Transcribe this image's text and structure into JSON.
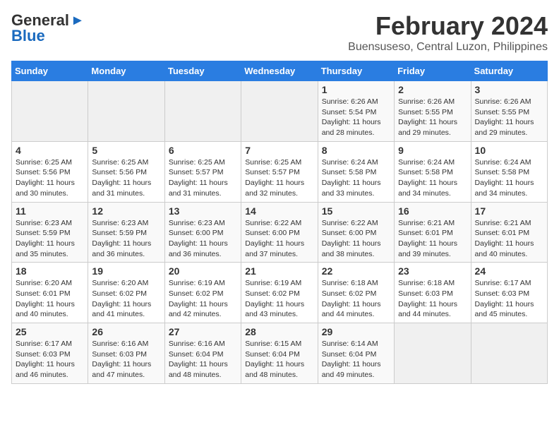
{
  "logo": {
    "line1": "General",
    "line2": "Blue",
    "arrow": "▶"
  },
  "title": "February 2024",
  "subtitle": "Buensuseso, Central Luzon, Philippines",
  "days_of_week": [
    "Sunday",
    "Monday",
    "Tuesday",
    "Wednesday",
    "Thursday",
    "Friday",
    "Saturday"
  ],
  "weeks": [
    [
      {
        "day": "",
        "info": ""
      },
      {
        "day": "",
        "info": ""
      },
      {
        "day": "",
        "info": ""
      },
      {
        "day": "",
        "info": ""
      },
      {
        "day": "1",
        "info": "Sunrise: 6:26 AM\nSunset: 5:54 PM\nDaylight: 11 hours\nand 28 minutes."
      },
      {
        "day": "2",
        "info": "Sunrise: 6:26 AM\nSunset: 5:55 PM\nDaylight: 11 hours\nand 29 minutes."
      },
      {
        "day": "3",
        "info": "Sunrise: 6:26 AM\nSunset: 5:55 PM\nDaylight: 11 hours\nand 29 minutes."
      }
    ],
    [
      {
        "day": "4",
        "info": "Sunrise: 6:25 AM\nSunset: 5:56 PM\nDaylight: 11 hours\nand 30 minutes."
      },
      {
        "day": "5",
        "info": "Sunrise: 6:25 AM\nSunset: 5:56 PM\nDaylight: 11 hours\nand 31 minutes."
      },
      {
        "day": "6",
        "info": "Sunrise: 6:25 AM\nSunset: 5:57 PM\nDaylight: 11 hours\nand 31 minutes."
      },
      {
        "day": "7",
        "info": "Sunrise: 6:25 AM\nSunset: 5:57 PM\nDaylight: 11 hours\nand 32 minutes."
      },
      {
        "day": "8",
        "info": "Sunrise: 6:24 AM\nSunset: 5:58 PM\nDaylight: 11 hours\nand 33 minutes."
      },
      {
        "day": "9",
        "info": "Sunrise: 6:24 AM\nSunset: 5:58 PM\nDaylight: 11 hours\nand 34 minutes."
      },
      {
        "day": "10",
        "info": "Sunrise: 6:24 AM\nSunset: 5:58 PM\nDaylight: 11 hours\nand 34 minutes."
      }
    ],
    [
      {
        "day": "11",
        "info": "Sunrise: 6:23 AM\nSunset: 5:59 PM\nDaylight: 11 hours\nand 35 minutes."
      },
      {
        "day": "12",
        "info": "Sunrise: 6:23 AM\nSunset: 5:59 PM\nDaylight: 11 hours\nand 36 minutes."
      },
      {
        "day": "13",
        "info": "Sunrise: 6:23 AM\nSunset: 6:00 PM\nDaylight: 11 hours\nand 36 minutes."
      },
      {
        "day": "14",
        "info": "Sunrise: 6:22 AM\nSunset: 6:00 PM\nDaylight: 11 hours\nand 37 minutes."
      },
      {
        "day": "15",
        "info": "Sunrise: 6:22 AM\nSunset: 6:00 PM\nDaylight: 11 hours\nand 38 minutes."
      },
      {
        "day": "16",
        "info": "Sunrise: 6:21 AM\nSunset: 6:01 PM\nDaylight: 11 hours\nand 39 minutes."
      },
      {
        "day": "17",
        "info": "Sunrise: 6:21 AM\nSunset: 6:01 PM\nDaylight: 11 hours\nand 40 minutes."
      }
    ],
    [
      {
        "day": "18",
        "info": "Sunrise: 6:20 AM\nSunset: 6:01 PM\nDaylight: 11 hours\nand 40 minutes."
      },
      {
        "day": "19",
        "info": "Sunrise: 6:20 AM\nSunset: 6:02 PM\nDaylight: 11 hours\nand 41 minutes."
      },
      {
        "day": "20",
        "info": "Sunrise: 6:19 AM\nSunset: 6:02 PM\nDaylight: 11 hours\nand 42 minutes."
      },
      {
        "day": "21",
        "info": "Sunrise: 6:19 AM\nSunset: 6:02 PM\nDaylight: 11 hours\nand 43 minutes."
      },
      {
        "day": "22",
        "info": "Sunrise: 6:18 AM\nSunset: 6:02 PM\nDaylight: 11 hours\nand 44 minutes."
      },
      {
        "day": "23",
        "info": "Sunrise: 6:18 AM\nSunset: 6:03 PM\nDaylight: 11 hours\nand 44 minutes."
      },
      {
        "day": "24",
        "info": "Sunrise: 6:17 AM\nSunset: 6:03 PM\nDaylight: 11 hours\nand 45 minutes."
      }
    ],
    [
      {
        "day": "25",
        "info": "Sunrise: 6:17 AM\nSunset: 6:03 PM\nDaylight: 11 hours\nand 46 minutes."
      },
      {
        "day": "26",
        "info": "Sunrise: 6:16 AM\nSunset: 6:03 PM\nDaylight: 11 hours\nand 47 minutes."
      },
      {
        "day": "27",
        "info": "Sunrise: 6:16 AM\nSunset: 6:04 PM\nDaylight: 11 hours\nand 48 minutes."
      },
      {
        "day": "28",
        "info": "Sunrise: 6:15 AM\nSunset: 6:04 PM\nDaylight: 11 hours\nand 48 minutes."
      },
      {
        "day": "29",
        "info": "Sunrise: 6:14 AM\nSunset: 6:04 PM\nDaylight: 11 hours\nand 49 minutes."
      },
      {
        "day": "",
        "info": ""
      },
      {
        "day": "",
        "info": ""
      }
    ]
  ]
}
